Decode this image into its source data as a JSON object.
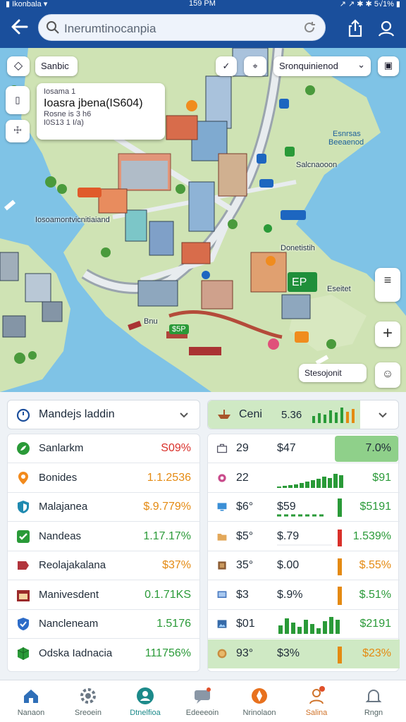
{
  "status": {
    "left": "▮ Ikonbala  ▾",
    "time": "159 PM",
    "right": "↗ ↗ ✱ ✱ 5√1% ▮"
  },
  "search": {
    "text": "Inerumtinocanpia"
  },
  "map": {
    "chip_left": "Sanbic",
    "chip_right": "Sronquinienod",
    "callout": {
      "line1": "Iosama 1",
      "title": "Ioasra jbena(IS604)",
      "line3": "Rosne is 3 h6",
      "line4": "I0S13 1 I/a)"
    },
    "labels": {
      "tl": "Iosoamontvicnitiaiand",
      "water1": "Esnrsas",
      "water2": "Beeaenod",
      "tr": "Salcnaooon",
      "mid": "Donetistih",
      "mid2": "Eseitet",
      "bottom": "Bnu",
      "br": "Stesojonit"
    },
    "badge_price": "$5P",
    "badge_sign": "EP"
  },
  "left_panel": {
    "dropdown": "Mandejs laddin",
    "rows": [
      {
        "icon": "leaf-icon",
        "name": "Sanlarkm",
        "value": "S09%",
        "color": "red",
        "iconColor": "#2a9a38"
      },
      {
        "icon": "location-pin-icon",
        "name": "Bonides",
        "value": "1.1.2536",
        "color": "orange",
        "iconColor": "#f28a1c"
      },
      {
        "icon": "shield-icon",
        "name": "Malajanea",
        "value": "$.9.779%",
        "color": "orange",
        "iconColor": "#1f8ab0"
      },
      {
        "icon": "check-icon",
        "name": "Nandeas",
        "value": "1.17.17%",
        "color": "green",
        "iconColor": "#2a9a38"
      },
      {
        "icon": "tag-icon",
        "name": "Reolajakalana",
        "value": "$37%",
        "color": "orange",
        "iconColor": "#b1343c"
      },
      {
        "icon": "calendar-icon",
        "name": "Manivesdent",
        "value": "0.1.71KS",
        "color": "green",
        "iconColor": "#9b2a2a"
      },
      {
        "icon": "shield-check-icon",
        "name": "Nancleneam",
        "value": "1.5176",
        "color": "green",
        "iconColor": "#2d6cc8"
      },
      {
        "icon": "cube-icon",
        "name": "Odska Iadnacia",
        "value": "111756%",
        "color": "green",
        "iconColor": "#2a9a38"
      }
    ]
  },
  "right_panel": {
    "dropdown": "Ceni",
    "dropdown_value": "5.36",
    "rows": [
      {
        "icon": "briefcase-icon",
        "a": "29",
        "b": "$47",
        "c": "7.0%",
        "color": "dark",
        "highlight": true,
        "spark": "none"
      },
      {
        "icon": "pin-dot-icon",
        "a": "22",
        "b": "",
        "c": "$91",
        "color": "green",
        "spark": "area"
      },
      {
        "icon": "monitor-icon",
        "a": "$6°",
        "b": "$59",
        "c": "$5191",
        "color": "green",
        "spark": "dash-green"
      },
      {
        "icon": "folder-icon",
        "a": "$5°",
        "b": "$.79",
        "c": "1.539%",
        "color": "green",
        "spark": "bar-red"
      },
      {
        "icon": "box-icon",
        "a": "35°",
        "b": "$.00",
        "c": "$.55%",
        "color": "orange",
        "spark": "bar-orange"
      },
      {
        "icon": "screen-icon",
        "a": "$3",
        "b": "$.9%",
        "c": "$.51%",
        "color": "green",
        "spark": "bar-orange2"
      },
      {
        "icon": "image-icon",
        "a": "$01",
        "b": "",
        "c": "$2191",
        "color": "green",
        "spark": "bars-green"
      },
      {
        "icon": "coin-icon",
        "a": "93°",
        "b": "$3%",
        "c": "$23%",
        "color": "orange",
        "highlight": true,
        "spark": "bar-orange"
      }
    ]
  },
  "bottom_nav": [
    {
      "icon": "home-icon",
      "label": "Nanaon"
    },
    {
      "icon": "gear-icon",
      "label": "Sreoein"
    },
    {
      "icon": "user-circle-icon",
      "label": "Dtnelfioa"
    },
    {
      "icon": "chat-icon",
      "label": "Edeeeoin"
    },
    {
      "icon": "compass-icon",
      "label": "Nrinolaon"
    },
    {
      "icon": "person-icon",
      "label": "Salina"
    },
    {
      "icon": "bell-icon",
      "label": "Rngn"
    }
  ],
  "colors": {
    "header": "#1a4f9c",
    "green": "#2a9a38",
    "red": "#d9302a",
    "orange": "#e48a12",
    "water": "#7fc3e6",
    "land": "#cfe3b4"
  }
}
